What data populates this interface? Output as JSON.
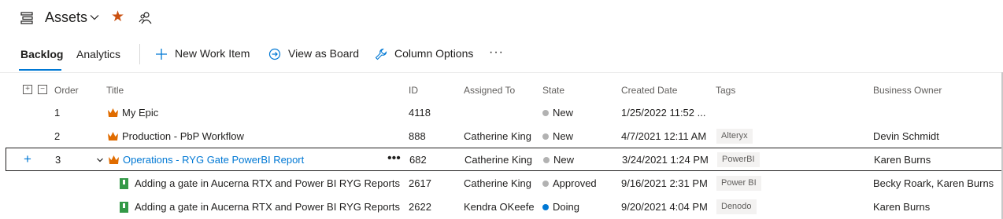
{
  "header": {
    "title": "Assets",
    "icon": "backlog-icon",
    "star_icon": "star-icon",
    "team_icon": "people-icon",
    "star_color": "#ca5010"
  },
  "toolbar": {
    "tabs": [
      {
        "label": "Backlog",
        "active": true
      },
      {
        "label": "Analytics",
        "active": false
      }
    ],
    "new_work_item": "New Work Item",
    "view_as_board": "View as Board",
    "column_options": "Column Options",
    "more": "···"
  },
  "columns": {
    "order": "Order",
    "title": "Title",
    "id": "ID",
    "assigned_to": "Assigned To",
    "state": "State",
    "created_date": "Created Date",
    "tags": "Tags",
    "business_owner": "Business Owner"
  },
  "rows": [
    {
      "order": "1",
      "title": "My Epic",
      "type": "epic",
      "id": "4118",
      "assigned_to": "",
      "state": "New",
      "state_color": "#b2b2b2",
      "created_date": "1/25/2022 11:52 ...",
      "tag": "",
      "business_owner": ""
    },
    {
      "order": "2",
      "title": "Production - PbP Workflow",
      "type": "epic",
      "id": "888",
      "assigned_to": "Catherine King",
      "state": "New",
      "state_color": "#b2b2b2",
      "created_date": "4/7/2021 12:11 AM",
      "tag": "Alteryx",
      "business_owner": "Devin Schmidt"
    },
    {
      "order": "3",
      "title": "Operations - RYG Gate PowerBI Report",
      "type": "epic",
      "id": "682",
      "assigned_to": "Catherine King",
      "state": "New",
      "state_color": "#b2b2b2",
      "created_date": "3/24/2021 1:24 PM",
      "tag": "PowerBI",
      "business_owner": "Karen Burns",
      "selected": true
    },
    {
      "order": "",
      "title": "Adding a gate in Aucerna RTX and Power BI RYG Reports",
      "type": "story",
      "id": "2617",
      "assigned_to": "Catherine King",
      "state": "Approved",
      "state_color": "#b2b2b2",
      "created_date": "9/16/2021 2:31 PM",
      "tag": "Power BI",
      "business_owner": "Becky Roark, Karen Burns"
    },
    {
      "order": "",
      "title": "Adding a gate in Aucerna RTX and Power BI RYG Reports",
      "type": "story",
      "id": "2622",
      "assigned_to": "Kendra OKeefe",
      "state": "Doing",
      "state_color": "#0078d4",
      "created_date": "9/20/2021 4:04 PM",
      "tag": "Denodo",
      "business_owner": "Karen Burns"
    }
  ],
  "colors": {
    "epic": "#e06c00",
    "story": "#339947",
    "accent": "#0078d4"
  }
}
